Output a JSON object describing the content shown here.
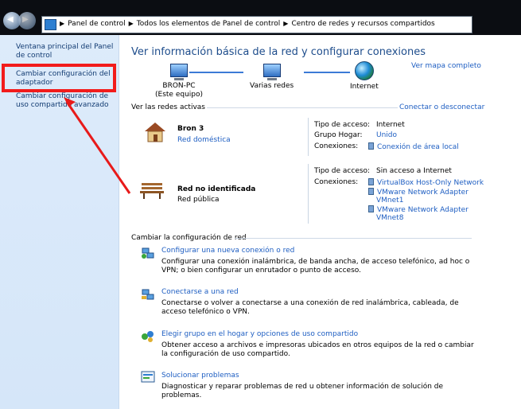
{
  "address": {
    "crumbs": [
      "Panel de control",
      "Todos los elementos de Panel de control",
      "Centro de redes y recursos compartidos"
    ]
  },
  "sidebar": {
    "items": [
      {
        "label": "Ventana principal del Panel de control"
      },
      {
        "label": "Cambiar configuración del adaptador"
      },
      {
        "label": "Cambiar configuración de uso compartido avanzado"
      }
    ]
  },
  "main": {
    "title": "Ver información básica de la red y configurar conexiones",
    "map_link": "Ver mapa completo",
    "nodes": {
      "pc_name": "BRON-PC",
      "pc_sub": "(Este equipo)",
      "middle": "Varias redes",
      "internet": "Internet"
    },
    "active_header": "Ver las redes activas",
    "connect_link": "Conectar o desconectar",
    "networks": [
      {
        "name": "Bron  3",
        "type": "Red doméstica",
        "labels": {
          "access": "Tipo de acceso:",
          "homegroup": "Grupo Hogar:",
          "connections": "Conexiones:"
        },
        "access": "Internet",
        "homegroup": "Unido",
        "connection": "Conexión de área local"
      },
      {
        "name": "Red no identificada",
        "type": "Red pública",
        "labels": {
          "access": "Tipo de acceso:",
          "connections": "Conexiones:"
        },
        "access": "Sin acceso a Internet",
        "connections": [
          "VirtualBox Host-Only Network",
          "VMware Network Adapter",
          "VMnet1",
          "VMware Network Adapter",
          "VMnet8"
        ]
      }
    ],
    "change_header": "Cambiar la configuración de red",
    "tasks": [
      {
        "title": "Configurar una nueva conexión o red",
        "desc": "Configurar una conexión inalámbrica, de banda ancha, de acceso telefónico, ad hoc o VPN; o bien configurar un enrutador o punto de acceso."
      },
      {
        "title": "Conectarse a una red",
        "desc": "Conectarse o volver a conectarse a una conexión de red inalámbrica, cableada, de acceso telefónico o VPN."
      },
      {
        "title": "Elegir grupo en el hogar y opciones de uso compartido",
        "desc": "Obtener acceso a archivos e impresoras ubicados en otros equipos de la red o cambiar la configuración de uso compartido."
      },
      {
        "title": "Solucionar problemas",
        "desc": "Diagnosticar y reparar problemas de red u obtener información de solución de problemas."
      }
    ]
  },
  "colors": {
    "link": "#1e5ec2",
    "title": "#1e4d8c",
    "highlight": "#f21b1b",
    "sidebar": "#d9e8fa"
  }
}
